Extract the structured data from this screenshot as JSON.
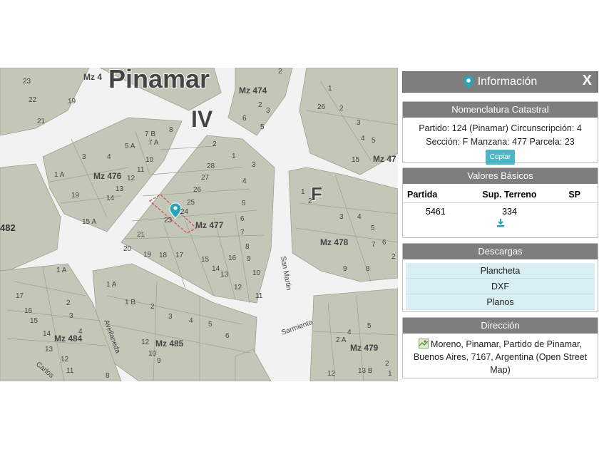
{
  "map": {
    "title": "Pinamar",
    "sector_iv": "IV",
    "sector_f": "F",
    "manzanas": [
      "Mz 474",
      "Mz 476",
      "Mz 477",
      "Mz 478",
      "Mz 484",
      "Mz 485",
      "Mz 479",
      "Mz 47"
    ],
    "streets": [
      "San Martin",
      "Sarmiento",
      "Avellaneda",
      "Carlos"
    ],
    "left_edge_label": "482",
    "parcel_numbers": [
      "23",
      "22",
      "19",
      "21",
      "2",
      "1",
      "3",
      "4",
      "5",
      "7 B",
      "7 A",
      "8",
      "6",
      "5 A",
      "10",
      "11",
      "12",
      "13",
      "14",
      "15 A",
      "19",
      "1 A",
      "20",
      "21",
      "19",
      "18",
      "17",
      "15",
      "14",
      "13",
      "12",
      "11",
      "10",
      "9",
      "8",
      "7",
      "6",
      "5",
      "4",
      "3",
      "2",
      "1",
      "28",
      "27",
      "26",
      "25",
      "24",
      "23",
      "16",
      "17",
      "15",
      "14",
      "13",
      "12",
      "11",
      "10",
      "9",
      "8",
      "7",
      "1 A",
      "1 B",
      "2",
      "3",
      "4",
      "5",
      "6",
      "1",
      "2",
      "3",
      "4",
      "5",
      "6",
      "7",
      "8",
      "9",
      "1",
      "26",
      "2",
      "3",
      "5",
      "2 A",
      "13 B",
      "2",
      "1"
    ],
    "selected_parcel": "23"
  },
  "panel": {
    "title": "Información",
    "close": "X",
    "nomenclatura": {
      "heading": "Nomenclatura Catastral",
      "line1": "Partido: 124 (Pinamar) Circunscripción: 4",
      "line2": "Sección: F Manzana: 477 Parcela: 23",
      "copy": "Copiar"
    },
    "valores": {
      "heading": "Valores Básicos",
      "col_partida": "Partida",
      "col_sup": "Sup. Terreno",
      "col_sp": "SP",
      "partida": "5461",
      "sup": "334",
      "sp": ""
    },
    "descargas": {
      "heading": "Descargas",
      "items": [
        "Plancheta",
        "DXF",
        "Planos"
      ]
    },
    "direccion": {
      "heading": "Dirección",
      "text": "Moreno, Pinamar, Partido de Pinamar, Buenos Aires, 7167, Argentina (Open Street Map)"
    }
  },
  "colors": {
    "block": "#c3c7b8",
    "street": "#f2f2f2",
    "accent": "#4db6c4",
    "header": "#7e7e7e"
  }
}
